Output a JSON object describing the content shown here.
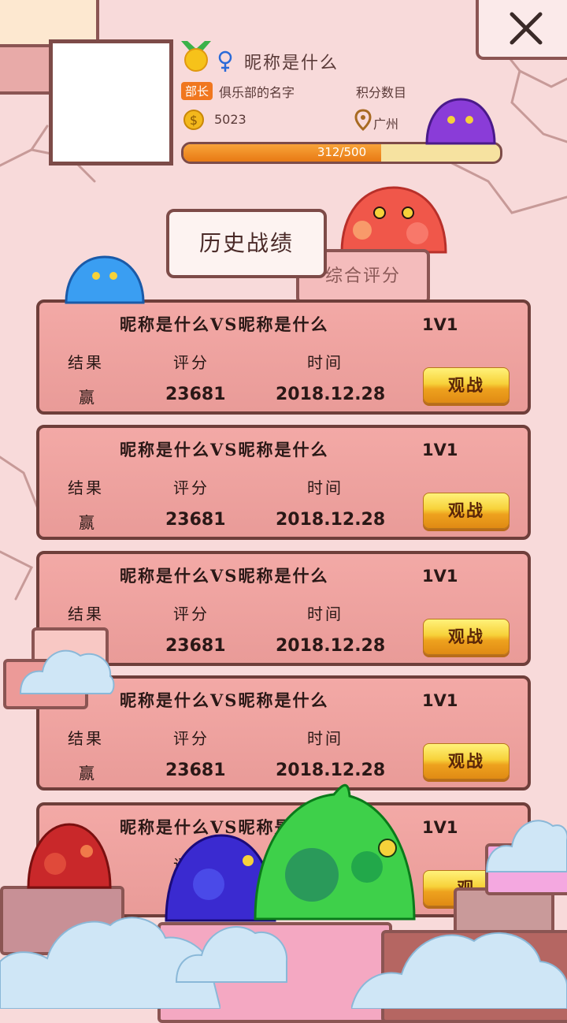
{
  "profile": {
    "nickname": "昵称是什么",
    "role": "部长",
    "club": "俱乐部的名字",
    "points_label": "积分数目",
    "coins": "5023",
    "city": "广州",
    "progress_text": "312/500",
    "progress_fraction": 0.624
  },
  "tabs": {
    "history": "历史战绩",
    "rating": "综合评分"
  },
  "headers": {
    "result": "结果",
    "score": "评分",
    "time": "时间"
  },
  "records": [
    {
      "title": "昵称是什么VS昵称是什么",
      "mode": "1V1",
      "result": "赢",
      "score": "23681",
      "time": "2018.12.28",
      "action": "观战"
    },
    {
      "title": "昵称是什么VS昵称是什么",
      "mode": "1V1",
      "result": "赢",
      "score": "23681",
      "time": "2018.12.28",
      "action": "观战"
    },
    {
      "title": "昵称是什么VS昵称是什么",
      "mode": "1V1",
      "result": "",
      "score": "23681",
      "time": "2018.12.28",
      "action": "观战"
    },
    {
      "title": "昵称是什么VS昵称是什么",
      "mode": "1V1",
      "result": "赢",
      "score": "23681",
      "time": "2018.12.28",
      "action": "观战"
    },
    {
      "title": "昵称是什么VS昵称是什么",
      "mode": "1V1",
      "result": "",
      "score": "",
      "time": "",
      "action": "观"
    }
  ],
  "colors": {
    "background": "#f8dada",
    "card": "#eda3a0",
    "border": "#6e3e3a",
    "accent": "#f0771f"
  },
  "icons": [
    "medal-icon",
    "female-icon",
    "coin-icon",
    "location-icon",
    "close-icon"
  ]
}
